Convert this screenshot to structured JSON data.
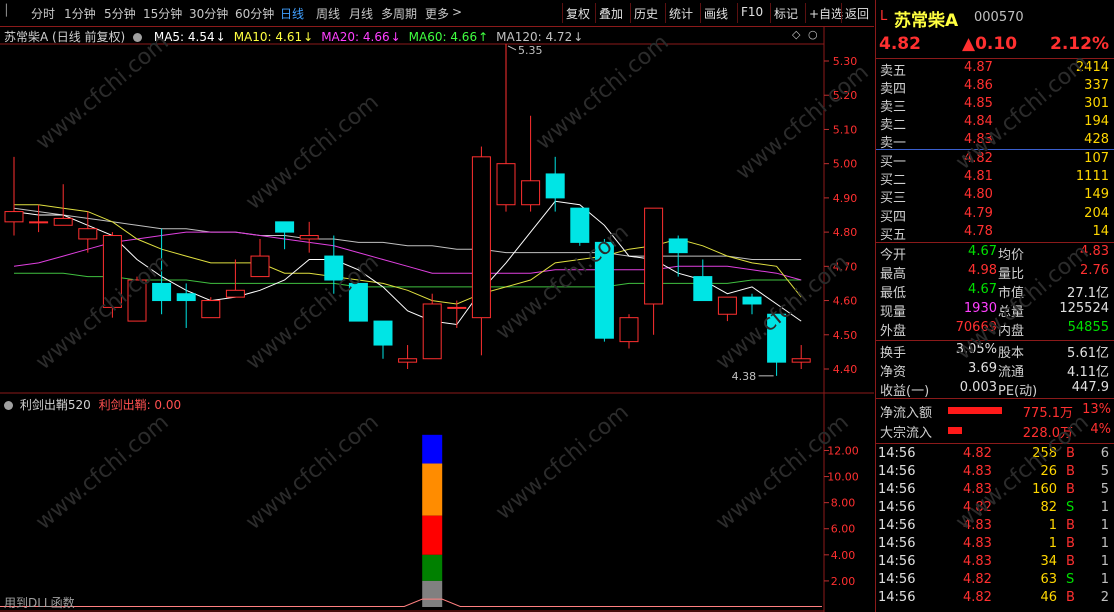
{
  "toolbar": {
    "left_items": [
      "分时",
      "1分钟",
      "5分钟",
      "15分钟",
      "30分钟",
      "60分钟",
      "日线",
      "周线",
      "月线",
      "多周期",
      "更多"
    ],
    "active": "日线",
    "more_arrow": ">",
    "right_items": [
      "复权",
      "叠加",
      "历史",
      "统计",
      "画线",
      "F10",
      "标记",
      "+自选",
      "返回"
    ]
  },
  "stock": {
    "marker": "L",
    "name": "苏常柴A",
    "code": "000570",
    "price": "4.82",
    "change": "▲0.10",
    "change_pct": "2.12%"
  },
  "main_chart": {
    "title": "苏常柴A (日线 前复权)",
    "ma": [
      {
        "label": "MA5: 4.54",
        "arrow": "↓",
        "color": "#ffffff"
      },
      {
        "label": "MA10: 4.61",
        "arrow": "↓",
        "color": "#ffff40"
      },
      {
        "label": "MA20: 4.66",
        "arrow": "↓",
        "color": "#ff40ff"
      },
      {
        "label": "MA60: 4.66",
        "arrow": "↑",
        "color": "#40ff40"
      },
      {
        "label": "MA120: 4.72",
        "arrow": "↓",
        "color": "#c0c0c0"
      }
    ],
    "high_label": "5.35",
    "low_label": "4.38",
    "y_ticks": [
      "5.30",
      "5.20",
      "5.10",
      "5.00",
      "4.90",
      "4.80",
      "4.70",
      "4.60",
      "4.50",
      "4.40"
    ]
  },
  "sub_chart": {
    "title": "利剑出鞘520",
    "value_label": "利剑出鞘: 0.00",
    "y_ticks": [
      "12.00",
      "10.00",
      "8.00",
      "6.00",
      "4.00",
      "2.00"
    ],
    "footer": "用到DLL函数",
    "stack_segments": [
      {
        "color": "#0000ff",
        "from": 11.0,
        "to": 13.2
      },
      {
        "color": "#ff8c00",
        "from": 7.0,
        "to": 11.0
      },
      {
        "color": "#ff0000",
        "from": 4.0,
        "to": 7.0
      },
      {
        "color": "#008000",
        "from": 2.0,
        "to": 4.0
      },
      {
        "color": "#808080",
        "from": 0.0,
        "to": 2.0
      }
    ]
  },
  "chart_data": {
    "type": "candlestick",
    "ylim": [
      4.35,
      5.38
    ],
    "candles": [
      {
        "o": 4.83,
        "c": 4.86,
        "h": 5.02,
        "l": 4.79
      },
      {
        "o": 4.83,
        "c": 4.83,
        "h": 4.88,
        "l": 4.8
      },
      {
        "o": 4.82,
        "c": 4.84,
        "h": 4.94,
        "l": 4.82
      },
      {
        "o": 4.78,
        "c": 4.81,
        "h": 4.86,
        "l": 4.74
      },
      {
        "o": 4.58,
        "c": 4.79,
        "h": 4.8,
        "l": 4.55
      },
      {
        "o": 4.54,
        "c": 4.66,
        "h": 4.67,
        "l": 4.54
      },
      {
        "o": 4.65,
        "c": 4.6,
        "h": 4.81,
        "l": 4.56
      },
      {
        "o": 4.62,
        "c": 4.6,
        "h": 4.65,
        "l": 4.52
      },
      {
        "o": 4.55,
        "c": 4.6,
        "h": 4.61,
        "l": 4.55
      },
      {
        "o": 4.61,
        "c": 4.63,
        "h": 4.72,
        "l": 4.61
      },
      {
        "o": 4.67,
        "c": 4.73,
        "h": 4.78,
        "l": 4.67
      },
      {
        "o": 4.83,
        "c": 4.8,
        "h": 4.83,
        "l": 4.75
      },
      {
        "o": 4.78,
        "c": 4.79,
        "h": 4.83,
        "l": 4.74
      },
      {
        "o": 4.73,
        "c": 4.66,
        "h": 4.79,
        "l": 4.62
      },
      {
        "o": 4.65,
        "c": 4.54,
        "h": 4.65,
        "l": 4.54
      },
      {
        "o": 4.54,
        "c": 4.47,
        "h": 4.54,
        "l": 4.43
      },
      {
        "o": 4.42,
        "c": 4.43,
        "h": 4.47,
        "l": 4.4
      },
      {
        "o": 4.43,
        "c": 4.59,
        "h": 4.62,
        "l": 4.43
      },
      {
        "o": 4.58,
        "c": 4.58,
        "h": 4.6,
        "l": 4.52
      },
      {
        "o": 4.55,
        "c": 5.02,
        "h": 5.05,
        "l": 4.44
      },
      {
        "o": 4.88,
        "c": 5.0,
        "h": 5.35,
        "l": 4.86
      },
      {
        "o": 4.88,
        "c": 4.95,
        "h": 5.14,
        "l": 4.86
      },
      {
        "o": 4.97,
        "c": 4.9,
        "h": 5.02,
        "l": 4.86
      },
      {
        "o": 4.87,
        "c": 4.77,
        "h": 4.87,
        "l": 4.76
      },
      {
        "o": 4.77,
        "c": 4.49,
        "h": 4.78,
        "l": 4.48
      },
      {
        "o": 4.48,
        "c": 4.55,
        "h": 4.56,
        "l": 4.46
      },
      {
        "o": 4.59,
        "c": 4.87,
        "h": 4.87,
        "l": 4.5
      },
      {
        "o": 4.78,
        "c": 4.74,
        "h": 4.79,
        "l": 4.67
      },
      {
        "o": 4.67,
        "c": 4.6,
        "h": 4.72,
        "l": 4.6
      },
      {
        "o": 4.56,
        "c": 4.61,
        "h": 4.61,
        "l": 4.54
      },
      {
        "o": 4.61,
        "c": 4.59,
        "h": 4.62,
        "l": 4.56
      },
      {
        "o": 4.56,
        "c": 4.42,
        "h": 4.56,
        "l": 4.38
      },
      {
        "o": 4.42,
        "c": 4.43,
        "h": 4.47,
        "l": 4.4
      }
    ],
    "ma5": [
      4.86,
      4.85,
      4.85,
      4.82,
      4.79,
      4.72,
      4.67,
      4.63,
      4.6,
      4.61,
      4.63,
      4.66,
      4.72,
      4.72,
      4.69,
      4.64,
      4.57,
      4.54,
      4.53,
      4.63,
      4.71,
      4.8,
      4.89,
      4.88,
      4.82,
      4.73,
      4.72,
      4.68,
      4.66,
      4.62,
      4.64,
      4.59,
      4.54
    ],
    "ma10": [
      4.88,
      4.88,
      4.87,
      4.86,
      4.83,
      4.78,
      4.75,
      4.73,
      4.71,
      4.71,
      4.71,
      4.68,
      4.68,
      4.67,
      4.66,
      4.65,
      4.63,
      4.6,
      4.59,
      4.62,
      4.64,
      4.66,
      4.71,
      4.72,
      4.73,
      4.75,
      4.76,
      4.78,
      4.76,
      4.73,
      4.71,
      4.7,
      4.61
    ],
    "ma20": [
      4.7,
      4.71,
      4.73,
      4.75,
      4.77,
      4.78,
      4.79,
      4.8,
      4.8,
      4.8,
      4.79,
      4.78,
      4.77,
      4.76,
      4.74,
      4.72,
      4.7,
      4.68,
      4.68,
      4.68,
      4.68,
      4.68,
      4.69,
      4.69,
      4.69,
      4.69,
      4.69,
      4.7,
      4.7,
      4.7,
      4.69,
      4.68,
      4.66
    ],
    "ma60": [
      4.68,
      4.68,
      4.68,
      4.67,
      4.67,
      4.66,
      4.66,
      4.66,
      4.65,
      4.65,
      4.65,
      4.65,
      4.65,
      4.65,
      4.64,
      4.64,
      4.64,
      4.64,
      4.64,
      4.64,
      4.64,
      4.64,
      4.64,
      4.64,
      4.64,
      4.65,
      4.65,
      4.65,
      4.65,
      4.65,
      4.66,
      4.66,
      4.66
    ],
    "ma120": [
      4.87,
      4.86,
      4.85,
      4.84,
      4.83,
      4.82,
      4.81,
      4.81,
      4.8,
      4.8,
      4.79,
      4.79,
      4.78,
      4.78,
      4.77,
      4.77,
      4.76,
      4.76,
      4.75,
      4.75,
      4.74,
      4.74,
      4.74,
      4.74,
      4.74,
      4.73,
      4.73,
      4.73,
      4.73,
      4.73,
      4.72,
      4.72,
      4.72
    ]
  },
  "order_book": {
    "asks": [
      {
        "label": "卖五",
        "price": "4.87",
        "vol": "2414"
      },
      {
        "label": "卖四",
        "price": "4.86",
        "vol": "337"
      },
      {
        "label": "卖三",
        "price": "4.85",
        "vol": "301"
      },
      {
        "label": "卖二",
        "price": "4.84",
        "vol": "194"
      },
      {
        "label": "卖一",
        "price": "4.83",
        "vol": "428"
      }
    ],
    "bids": [
      {
        "label": "买一",
        "price": "4.82",
        "vol": "107"
      },
      {
        "label": "买二",
        "price": "4.81",
        "vol": "1111"
      },
      {
        "label": "买三",
        "price": "4.80",
        "vol": "149"
      },
      {
        "label": "买四",
        "price": "4.79",
        "vol": "204"
      },
      {
        "label": "买五",
        "price": "4.78",
        "vol": "14"
      }
    ]
  },
  "quote": [
    {
      "l1": "今开",
      "v1": "4.67",
      "c1": "green",
      "l2": "均价",
      "v2": "4.83",
      "c2": "red"
    },
    {
      "l1": "最高",
      "v1": "4.98",
      "c1": "red",
      "l2": "量比",
      "v2": "2.76",
      "c2": "red"
    },
    {
      "l1": "最低",
      "v1": "4.67",
      "c1": "green",
      "l2": "市值",
      "v2": "27.1亿",
      "c2": "white"
    },
    {
      "l1": "现量",
      "v1": "1930",
      "c1": "magenta",
      "l2": "总量",
      "v2": "125524",
      "c2": "white"
    },
    {
      "l1": "外盘",
      "v1": "70669",
      "c1": "red",
      "l2": "内盘",
      "v2": "54855",
      "c2": "green"
    }
  ],
  "finance": [
    {
      "l1": "换手",
      "v1": "3.05%",
      "l2": "股本",
      "v2": "5.61亿"
    },
    {
      "l1": "净资",
      "v1": "3.69",
      "l2": "流通",
      "v2": "4.11亿"
    },
    {
      "l1": "收益(一)",
      "v1": "0.003",
      "l2": "PE(动)",
      "v2": "447.9"
    }
  ],
  "flows": [
    {
      "label": "净流入额",
      "value": "775.1万",
      "pct": "13%",
      "bar": 0.45
    },
    {
      "label": "大宗流入",
      "value": "228.0万",
      "pct": "4%",
      "bar": 0.12
    }
  ],
  "ticks": [
    {
      "t": "14:56",
      "p": "4.82",
      "v": "258",
      "s": "B",
      "n": "6"
    },
    {
      "t": "14:56",
      "p": "4.83",
      "v": "26",
      "s": "B",
      "n": "5"
    },
    {
      "t": "14:56",
      "p": "4.83",
      "v": "160",
      "s": "B",
      "n": "5"
    },
    {
      "t": "14:56",
      "p": "4.82",
      "v": "82",
      "s": "S",
      "n": "1"
    },
    {
      "t": "14:56",
      "p": "4.83",
      "v": "1",
      "s": "B",
      "n": "1"
    },
    {
      "t": "14:56",
      "p": "4.83",
      "v": "1",
      "s": "B",
      "n": "1"
    },
    {
      "t": "14:56",
      "p": "4.83",
      "v": "34",
      "s": "B",
      "n": "1"
    },
    {
      "t": "14:56",
      "p": "4.82",
      "v": "63",
      "s": "S",
      "n": "1"
    },
    {
      "t": "14:56",
      "p": "4.82",
      "v": "46",
      "s": "B",
      "n": "2"
    }
  ],
  "watermark": "www.cfchi.com"
}
